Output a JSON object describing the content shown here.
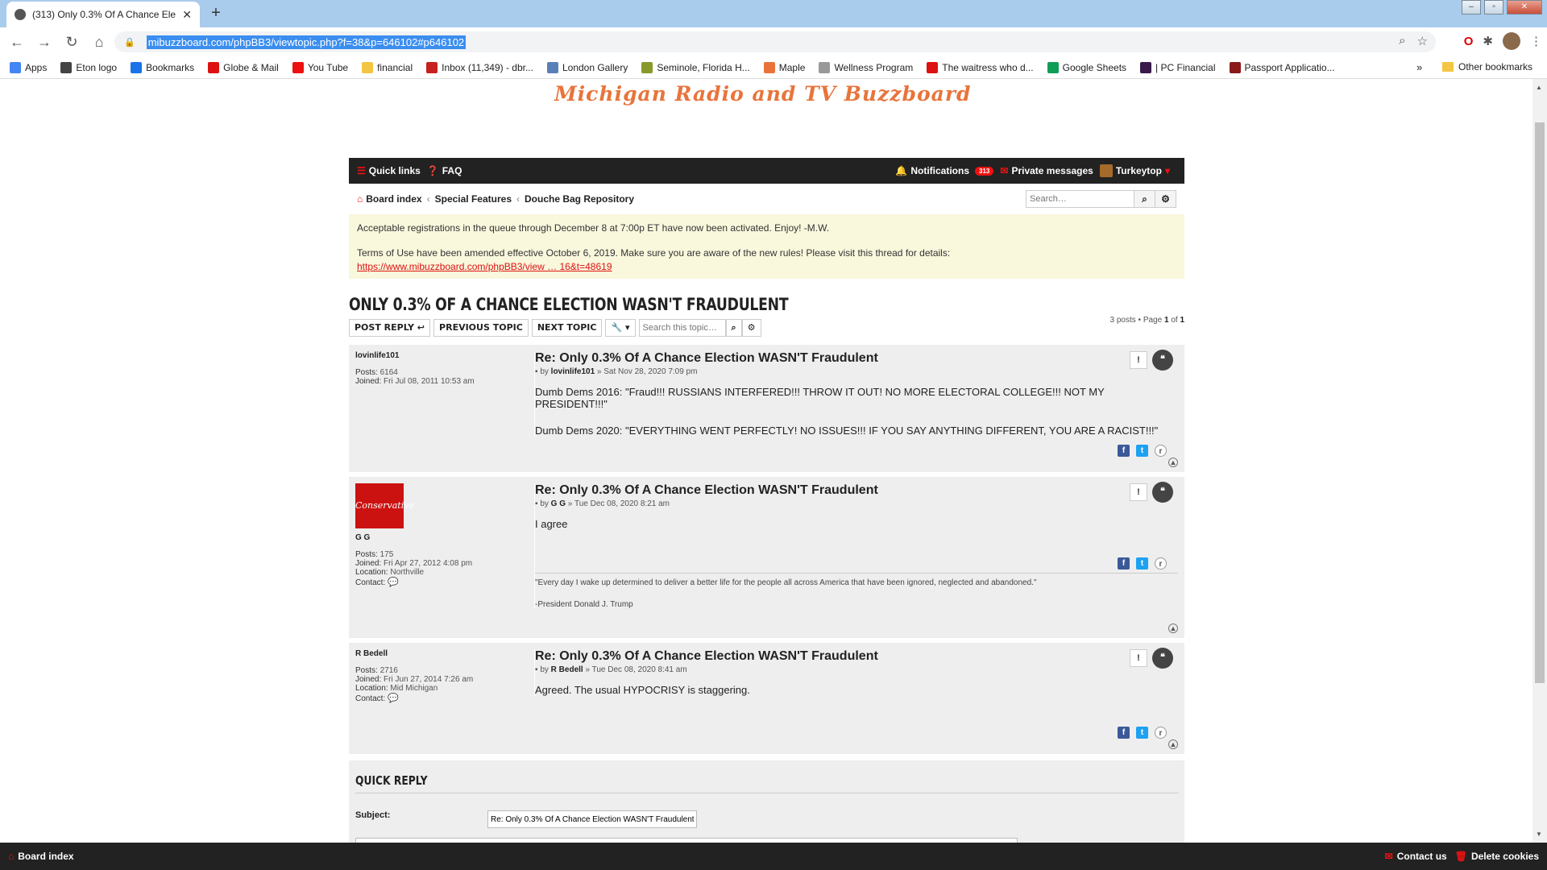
{
  "browser": {
    "tab_title": "(313) Only 0.3% Of A Chance Ele",
    "url": "mibuzzboard.com/phpBB3/viewtopic.php?f=38&p=646102#p646102",
    "bookmarks": [
      {
        "label": "Apps",
        "color": "#4285f4"
      },
      {
        "label": "Eton logo",
        "color": "#444"
      },
      {
        "label": "Bookmarks",
        "color": "#1a73e8"
      },
      {
        "label": "Globe & Mail",
        "color": "#d11"
      },
      {
        "label": "You Tube",
        "color": "#e11"
      },
      {
        "label": "financial",
        "color": "#f4c542"
      },
      {
        "label": "Inbox (11,349) - dbr...",
        "color": "#c5221f"
      },
      {
        "label": "London Gallery",
        "color": "#5a7fb8"
      },
      {
        "label": "Seminole, Florida H...",
        "color": "#8a9a2a"
      },
      {
        "label": "Maple",
        "color": "#e8743b"
      },
      {
        "label": "Wellness Program",
        "color": "#999"
      },
      {
        "label": "The waitress who d...",
        "color": "#d11"
      },
      {
        "label": "Google Sheets",
        "color": "#0f9d58"
      },
      {
        "label": "| PC Financial",
        "color": "#3a1a4a"
      },
      {
        "label": "Passport Applicatio...",
        "color": "#8a1a1a"
      }
    ],
    "bookmarks_more": "»",
    "other_bookmarks": "Other bookmarks"
  },
  "site": {
    "banner": "Michigan Radio and TV Buzzboard",
    "nav": {
      "quick_links": "Quick links",
      "faq": "FAQ",
      "notifications": "Notifications",
      "notifications_count": "313",
      "private_messages": "Private messages",
      "username": "Turkeytop"
    },
    "breadcrumbs": [
      "Board index",
      "Special Features",
      "Douche Bag Repository"
    ],
    "search_placeholder": "Search…",
    "announcement": {
      "line1": "Acceptable registrations in the queue through December 8 at 7:00p ET have now been activated. Enjoy! -M.W.",
      "line2": "Terms of Use have been amended effective October 6, 2019. Make sure you are aware of the new rules! Please visit this thread for details:",
      "link": "https://www.mibuzzboard.com/phpBB3/view … 16&t=48619"
    },
    "topic_title": "ONLY 0.3% OF A CHANCE ELECTION WASN'T FRAUDULENT",
    "actions": {
      "post_reply": "POST REPLY ↩",
      "previous_topic": "PREVIOUS TOPIC",
      "next_topic": "NEXT TOPIC",
      "search_topic_placeholder": "Search this topic…"
    },
    "pagination": {
      "posts": "3 posts • Page",
      "page": "1",
      "of": "of",
      "total": "1"
    },
    "posts": [
      {
        "author": "lovinlife101",
        "posts_label": "Posts:",
        "posts_value": "6164",
        "joined_label": "Joined:",
        "joined_value": "Fri Jul 08, 2011 10:53 am",
        "title": "Re: Only 0.3% Of A Chance Election WASN'T Fraudulent",
        "meta_by": "by",
        "meta_author": "lovinlife101",
        "meta_date": "» Sat Nov 28, 2020 7:09 pm",
        "content": [
          "Dumb Dems 2016: \"Fraud!!! RUSSIANS INTERFERED!!! THROW IT OUT! NO MORE ELECTORAL COLLEGE!!! NOT MY PRESIDENT!!!\"",
          "Dumb Dems 2020: \"EVERYTHING WENT PERFECTLY! NO ISSUES!!! IF YOU SAY ANYTHING DIFFERENT, YOU ARE A RACIST!!!\""
        ]
      },
      {
        "author": "G G",
        "avatar_text": "Conservative",
        "posts_label": "Posts:",
        "posts_value": "175",
        "joined_label": "Joined:",
        "joined_value": "Fri Apr 27, 2012 4:08 pm",
        "location_label": "Location:",
        "location_value": "Northville",
        "contact_label": "Contact:",
        "title": "Re: Only 0.3% Of A Chance Election WASN'T Fraudulent",
        "meta_by": "by",
        "meta_author": "G G",
        "meta_date": "» Tue Dec 08, 2020 8:21 am",
        "content": [
          "I agree"
        ],
        "signature": [
          "\"Every day I wake up determined to deliver a better life for the people all across America that have been ignored, neglected and abandoned.\"",
          "-President Donald J. Trump"
        ]
      },
      {
        "author": "R Bedell",
        "posts_label": "Posts:",
        "posts_value": "2716",
        "joined_label": "Joined:",
        "joined_value": "Fri Jun 27, 2014 7:26 am",
        "location_label": "Location:",
        "location_value": "Mid Michigan",
        "contact_label": "Contact:",
        "title": "Re: Only 0.3% Of A Chance Election WASN'T Fraudulent",
        "meta_by": "by",
        "meta_author": "R Bedell",
        "meta_date": "» Tue Dec 08, 2020 8:41 am",
        "content": [
          "Agreed. The usual HYPOCRISY is staggering."
        ]
      }
    ],
    "quick_reply": {
      "title": "QUICK REPLY",
      "subject_label": "Subject:",
      "subject_value": "Re: Only 0.3% Of A Chance Election WASN'T Fraudulent"
    },
    "footer": {
      "board_index": "Board index",
      "contact_us": "Contact us",
      "delete_cookies": "Delete cookies"
    }
  },
  "colors": {
    "accent_red": "#e11111",
    "banner_orange": "#e8743b",
    "navbar": "#222222",
    "announce_bg": "#f9f7dc"
  }
}
